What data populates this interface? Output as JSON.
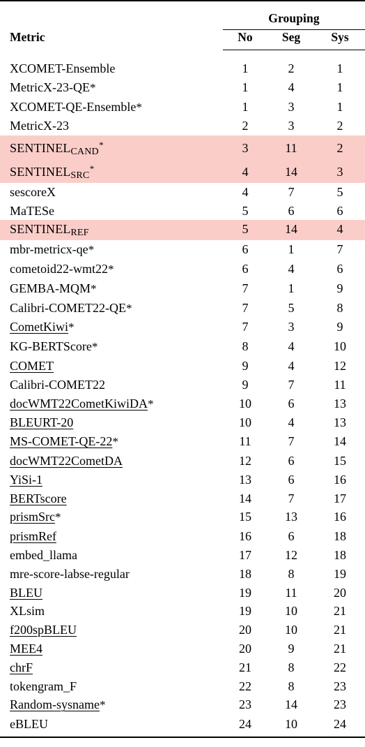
{
  "table": {
    "header": {
      "metric_label": "Metric",
      "group_label": "Grouping",
      "columns": [
        "No",
        "Seg",
        "Sys"
      ]
    },
    "highlight_color": "#fbcdc9",
    "rows": [
      {
        "metric": "XCOMET-Ensemble",
        "no": "1",
        "seg": "2",
        "sys": "1",
        "underlined": false,
        "highlight": false,
        "star": false
      },
      {
        "metric": "MetricX-23-QE",
        "no": "1",
        "seg": "4",
        "sys": "1",
        "underlined": false,
        "highlight": false,
        "star": true
      },
      {
        "metric": "XCOMET-QE-Ensemble",
        "no": "1",
        "seg": "3",
        "sys": "1",
        "underlined": false,
        "highlight": false,
        "star": true
      },
      {
        "metric": "MetricX-23",
        "no": "2",
        "seg": "3",
        "sys": "2",
        "underlined": false,
        "highlight": false,
        "star": false
      },
      {
        "metric": "SENTINEL",
        "subscript": "CAND",
        "no": "3",
        "seg": "11",
        "sys": "2",
        "underlined": false,
        "highlight": true,
        "star": true,
        "smallcaps": true
      },
      {
        "metric": "SENTINEL",
        "subscript": "SRC",
        "no": "4",
        "seg": "14",
        "sys": "3",
        "underlined": false,
        "highlight": true,
        "star": true,
        "smallcaps": true
      },
      {
        "metric": "sescoreX",
        "no": "4",
        "seg": "7",
        "sys": "5",
        "underlined": false,
        "highlight": false,
        "star": false
      },
      {
        "metric": "MaTESe",
        "no": "5",
        "seg": "6",
        "sys": "6",
        "underlined": false,
        "highlight": false,
        "star": false
      },
      {
        "metric": "SENTINEL",
        "subscript": "REF",
        "no": "5",
        "seg": "14",
        "sys": "4",
        "underlined": false,
        "highlight": true,
        "star": false,
        "smallcaps": true
      },
      {
        "metric": "mbr-metricx-qe",
        "no": "6",
        "seg": "1",
        "sys": "7",
        "underlined": false,
        "highlight": false,
        "star": true
      },
      {
        "metric": "cometoid22-wmt22",
        "no": "6",
        "seg": "4",
        "sys": "6",
        "underlined": false,
        "highlight": false,
        "star": true
      },
      {
        "metric": "GEMBA-MQM",
        "no": "7",
        "seg": "1",
        "sys": "9",
        "underlined": false,
        "highlight": false,
        "star": true
      },
      {
        "metric": "Calibri-COMET22-QE",
        "no": "7",
        "seg": "5",
        "sys": "8",
        "underlined": false,
        "highlight": false,
        "star": true
      },
      {
        "metric": "CometKiwi",
        "no": "7",
        "seg": "3",
        "sys": "9",
        "underlined": true,
        "highlight": false,
        "star": true
      },
      {
        "metric": "KG-BERTScore",
        "no": "8",
        "seg": "4",
        "sys": "10",
        "underlined": false,
        "highlight": false,
        "star": true
      },
      {
        "metric": "COMET",
        "no": "9",
        "seg": "4",
        "sys": "12",
        "underlined": true,
        "highlight": false,
        "star": false
      },
      {
        "metric": "Calibri-COMET22",
        "no": "9",
        "seg": "7",
        "sys": "11",
        "underlined": false,
        "highlight": false,
        "star": false
      },
      {
        "metric": "docWMT22CometKiwiDA",
        "no": "10",
        "seg": "6",
        "sys": "13",
        "underlined": true,
        "highlight": false,
        "star": true
      },
      {
        "metric": "BLEURT-20",
        "no": "10",
        "seg": "4",
        "sys": "13",
        "underlined": true,
        "highlight": false,
        "star": false
      },
      {
        "metric": "MS-COMET-QE-22",
        "no": "11",
        "seg": "7",
        "sys": "14",
        "underlined": true,
        "highlight": false,
        "star": true
      },
      {
        "metric": "docWMT22CometDA",
        "no": "12",
        "seg": "6",
        "sys": "15",
        "underlined": true,
        "highlight": false,
        "star": false
      },
      {
        "metric": "YiSi-1",
        "no": "13",
        "seg": "6",
        "sys": "16",
        "underlined": true,
        "highlight": false,
        "star": false
      },
      {
        "metric": "BERTscore",
        "no": "14",
        "seg": "7",
        "sys": "17",
        "underlined": true,
        "highlight": false,
        "star": false
      },
      {
        "metric": "prismSrc",
        "no": "15",
        "seg": "13",
        "sys": "16",
        "underlined": true,
        "highlight": false,
        "star": true
      },
      {
        "metric": "prismRef",
        "no": "16",
        "seg": "6",
        "sys": "18",
        "underlined": true,
        "highlight": false,
        "star": false
      },
      {
        "metric": "embed_llama",
        "no": "17",
        "seg": "12",
        "sys": "18",
        "underlined": false,
        "highlight": false,
        "star": false
      },
      {
        "metric": "mre-score-labse-regular",
        "no": "18",
        "seg": "8",
        "sys": "19",
        "underlined": false,
        "highlight": false,
        "star": false
      },
      {
        "metric": "BLEU",
        "no": "19",
        "seg": "11",
        "sys": "20",
        "underlined": true,
        "highlight": false,
        "star": false
      },
      {
        "metric": "XLsim",
        "no": "19",
        "seg": "10",
        "sys": "21",
        "underlined": false,
        "highlight": false,
        "star": false
      },
      {
        "metric": "f200spBLEU",
        "no": "20",
        "seg": "10",
        "sys": "21",
        "underlined": true,
        "highlight": false,
        "star": false
      },
      {
        "metric": "MEE4",
        "no": "20",
        "seg": "9",
        "sys": "21",
        "underlined": true,
        "highlight": false,
        "star": false
      },
      {
        "metric": "chrF",
        "no": "21",
        "seg": "8",
        "sys": "22",
        "underlined": true,
        "highlight": false,
        "star": false
      },
      {
        "metric": "tokengram_F",
        "no": "22",
        "seg": "8",
        "sys": "23",
        "underlined": false,
        "highlight": false,
        "star": false
      },
      {
        "metric": "Random-sysname",
        "no": "23",
        "seg": "14",
        "sys": "23",
        "underlined": true,
        "highlight": false,
        "star": true
      },
      {
        "metric": "eBLEU",
        "no": "24",
        "seg": "10",
        "sys": "24",
        "underlined": false,
        "highlight": false,
        "star": false
      }
    ]
  }
}
